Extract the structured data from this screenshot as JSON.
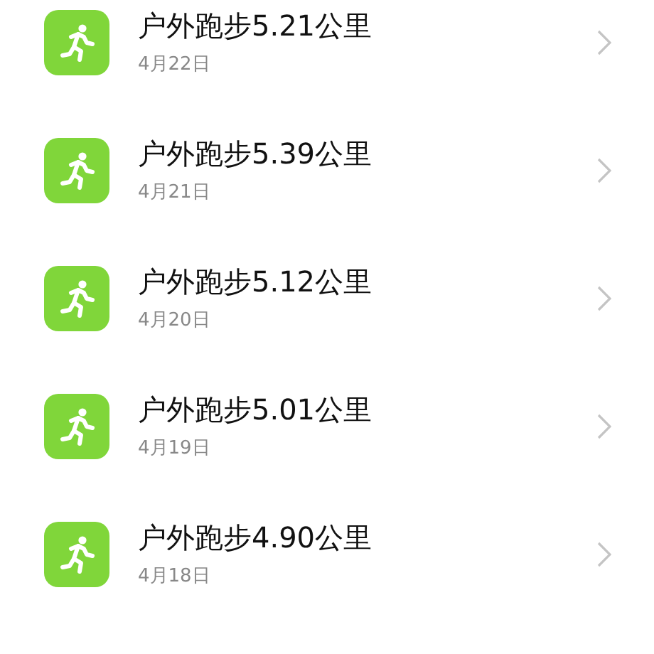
{
  "records": [
    {
      "title": "户外跑步5.21公里",
      "date": "4月22日"
    },
    {
      "title": "户外跑步5.39公里",
      "date": "4月21日"
    },
    {
      "title": "户外跑步5.12公里",
      "date": "4月20日"
    },
    {
      "title": "户外跑步5.01公里",
      "date": "4月19日"
    },
    {
      "title": "户外跑步4.90公里",
      "date": "4月18日"
    }
  ]
}
